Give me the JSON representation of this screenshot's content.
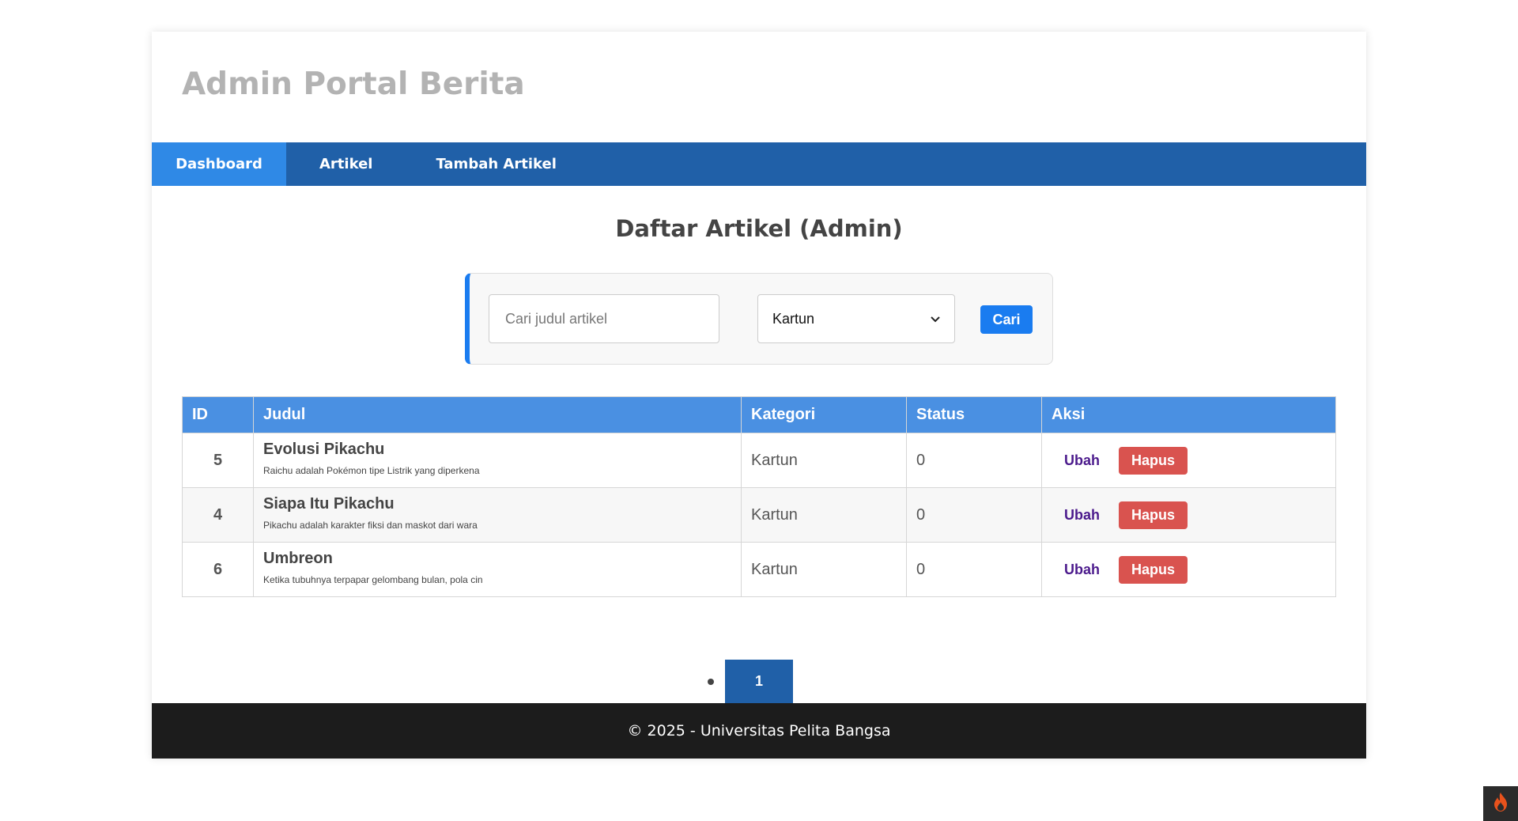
{
  "header": {
    "title": "Admin Portal Berita"
  },
  "nav": {
    "items": [
      {
        "label": "Dashboard",
        "active": true
      },
      {
        "label": "Artikel",
        "active": false
      },
      {
        "label": "Tambah Artikel",
        "active": false
      }
    ]
  },
  "main": {
    "title": "Daftar Artikel (Admin)"
  },
  "search": {
    "placeholder": "Cari judul artikel",
    "category_selected": "Kartun",
    "button_label": "Cari"
  },
  "table": {
    "headers": [
      "ID",
      "Judul",
      "Kategori",
      "Status",
      "Aksi"
    ],
    "rows": [
      {
        "id": "5",
        "title": "Evolusi Pikachu",
        "excerpt": "Raichu adalah Pokémon tipe Listrik yang diperkena",
        "category": "Kartun",
        "status": "0",
        "edit_label": "Ubah",
        "delete_label": "Hapus"
      },
      {
        "id": "4",
        "title": "Siapa Itu Pikachu",
        "excerpt": "Pikachu adalah karakter fiksi dan maskot dari wara",
        "category": "Kartun",
        "status": "0",
        "edit_label": "Ubah",
        "delete_label": "Hapus"
      },
      {
        "id": "6",
        "title": "Umbreon",
        "excerpt": "Ketika tubuhnya terpapar gelombang bulan, pola cin",
        "category": "Kartun",
        "status": "0",
        "edit_label": "Ubah",
        "delete_label": "Hapus"
      }
    ]
  },
  "pagination": {
    "current": "1"
  },
  "footer": {
    "text": "© 2025 - Universitas Pelita Bangsa"
  },
  "colors": {
    "nav_bg": "#2060a8",
    "nav_active": "#2f89e6",
    "table_header": "#4a90e2",
    "delete_button": "#d9534f",
    "search_button": "#1a7cf0",
    "footer_bg": "#1c1c1c"
  },
  "icons": {
    "corner": "flame-icon",
    "select": "chevron-down-icon"
  }
}
